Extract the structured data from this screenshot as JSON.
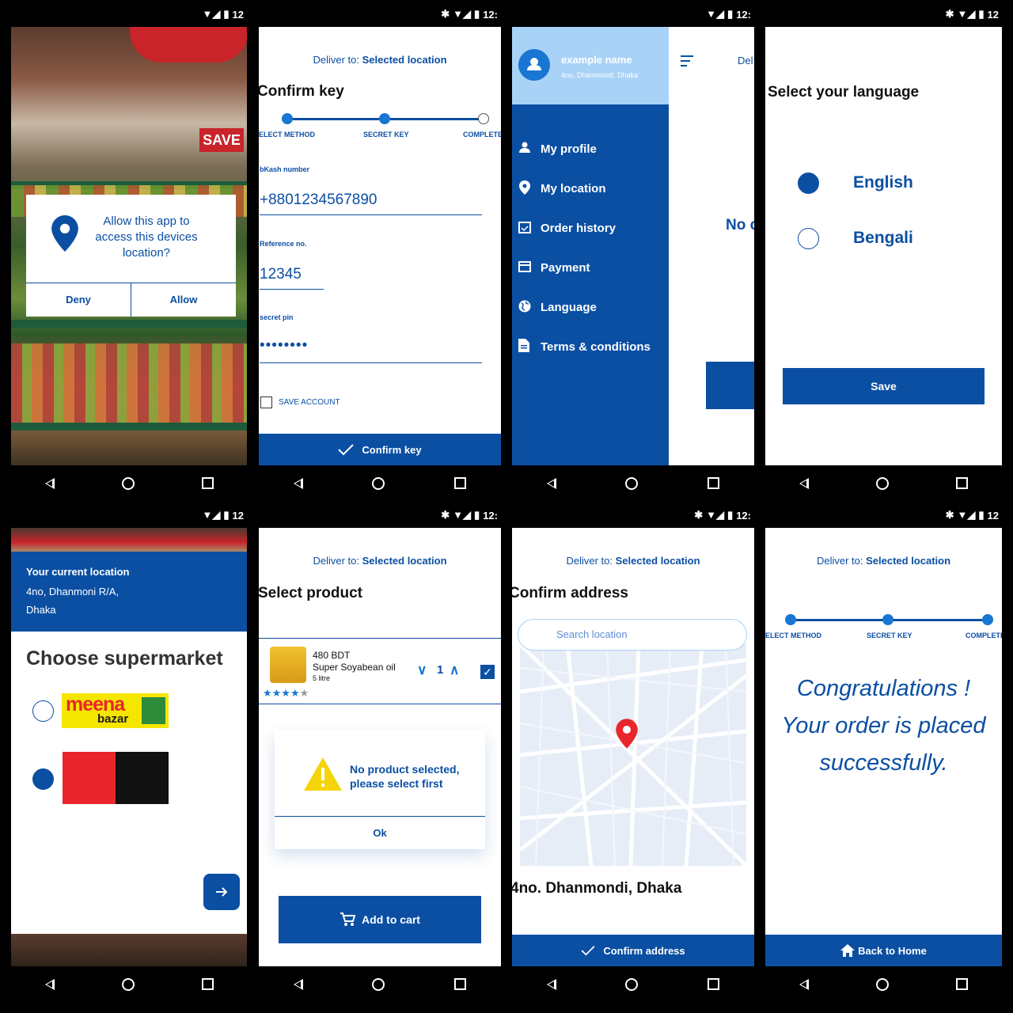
{
  "status": {
    "time": "12",
    "time_cut": "12:"
  },
  "deliver": {
    "prefix": "Deliver to:",
    "location": "Selected location"
  },
  "permission": {
    "text": "Allow this app to access this devices location?",
    "deny": "Deny",
    "allow": "Allow",
    "sign": "SAVE"
  },
  "confirm_key": {
    "title": "Confirm key",
    "steps": [
      "SELECT METHOD",
      "SECRET KEY",
      "COMPLETE"
    ],
    "bkash_label": "bKash number",
    "bkash_value": "+8801234567890",
    "ref_label": "Reference no.",
    "ref_value": "12345",
    "pin_label": "secret pin",
    "pin_value": "••••••••",
    "save_account": "SAVE ACCOUNT",
    "button": "Confirm key"
  },
  "drawer": {
    "user_name": "example name",
    "user_address": "4no, Dhanmondi, Dhaka",
    "items": [
      {
        "label": "My profile",
        "icon": "person-icon"
      },
      {
        "label": "My location",
        "icon": "location-pin-icon"
      },
      {
        "label": "Order history",
        "icon": "calendar-icon"
      },
      {
        "label": "Payment",
        "icon": "credit-card-icon"
      },
      {
        "label": "Language",
        "icon": "globe-icon"
      },
      {
        "label": "Terms & conditions",
        "icon": "document-icon"
      }
    ],
    "peek_deliver": "Del",
    "peek_text": "No c"
  },
  "language": {
    "title": "Select your language",
    "options": [
      {
        "label": "English",
        "selected": true
      },
      {
        "label": "Bengali",
        "selected": false
      }
    ],
    "save": "Save"
  },
  "supermarket": {
    "loc_title": "Your current location",
    "loc_line1": "4no, Dhanmoni R/A,",
    "loc_line2": "Dhaka",
    "title": "Choose supermarket",
    "markets": [
      {
        "name": "meena",
        "name2": "bazar",
        "selected": false
      },
      {
        "name": "",
        "selected": true
      }
    ]
  },
  "product": {
    "title": "Select product",
    "price": "480 BDT",
    "name": "Super Soyabean oil",
    "size": "5 litre",
    "qty": "1",
    "rating": 4,
    "alert": "No product selected, please select first",
    "ok": "Ok",
    "add_to_cart": "Add to cart"
  },
  "address": {
    "title": "Confirm address",
    "search_placeholder": "Search location",
    "address": "4no. Dhanmondi, Dhaka",
    "button": "Confirm address"
  },
  "done": {
    "line1": "Congratulations !",
    "line2": "Your order is placed",
    "line3": "successfully.",
    "button": "Back to Home"
  },
  "colors": {
    "primary": "#0b4fa3",
    "light": "#a9d2f7",
    "danger": "#e8262b",
    "warning": "#f5d50a"
  }
}
